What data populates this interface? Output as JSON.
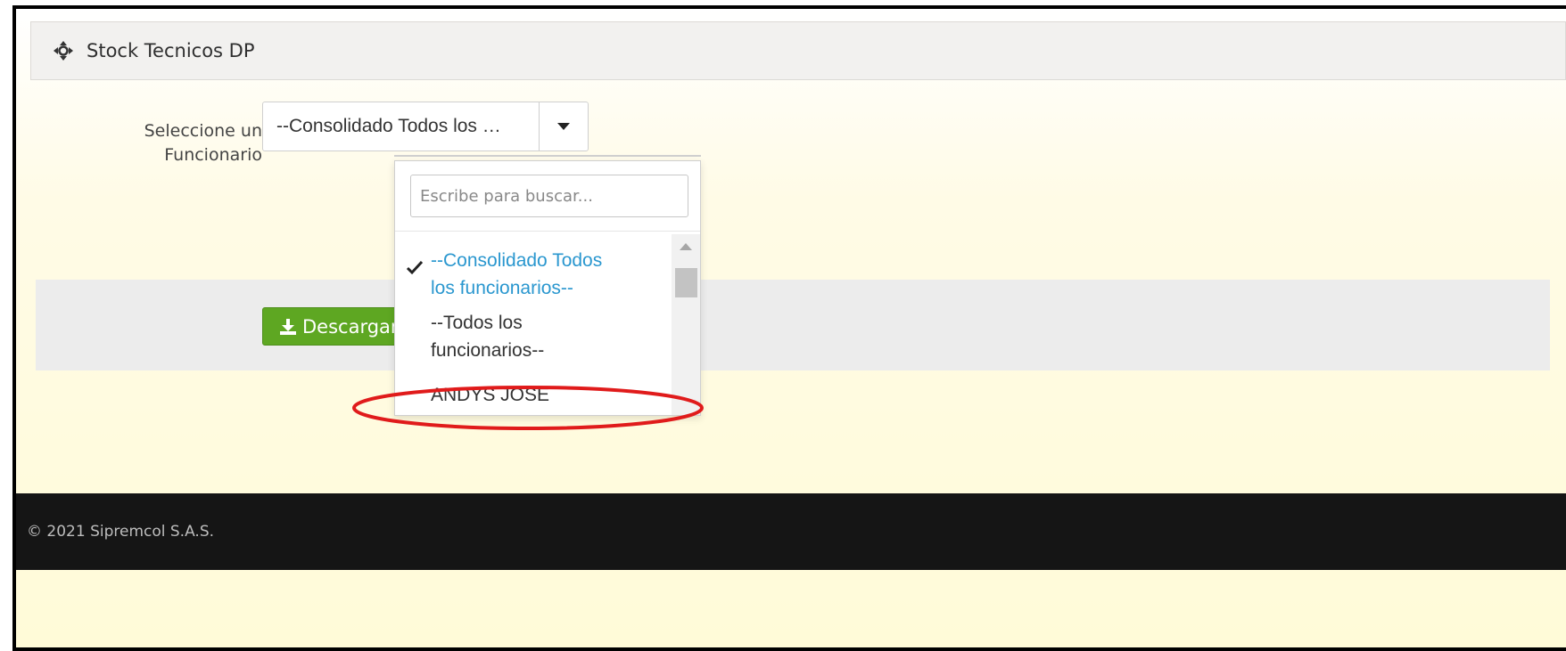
{
  "panel": {
    "title": "Stock Tecnicos DP",
    "icon": "crosshair-arrows-icon"
  },
  "form": {
    "label": "Seleccione un Funcionario",
    "label_line1": "Seleccione un",
    "label_line2": "Funcionario",
    "select_value": "--Consolidado Todos los …"
  },
  "dropdown": {
    "search_placeholder": "Escribe para buscar...",
    "options": [
      {
        "line1": "--Consolidado Todos",
        "line2": "los funcionarios--",
        "selected": true
      },
      {
        "line1": "--Todos los",
        "line2": "funcionarios--",
        "selected": false
      },
      {
        "line1": "ANDYS JOSE",
        "line2": "",
        "selected": false,
        "highlighted": true
      }
    ]
  },
  "download_button": {
    "label": "Descargar"
  },
  "footer": {
    "copyright": "© 2021 Sipremcol S.A.S."
  },
  "colors": {
    "accent_blue": "#2a97cf",
    "button_green": "#5ea722",
    "footer_bg": "#151515",
    "annotation_red": "#e01b1b"
  }
}
